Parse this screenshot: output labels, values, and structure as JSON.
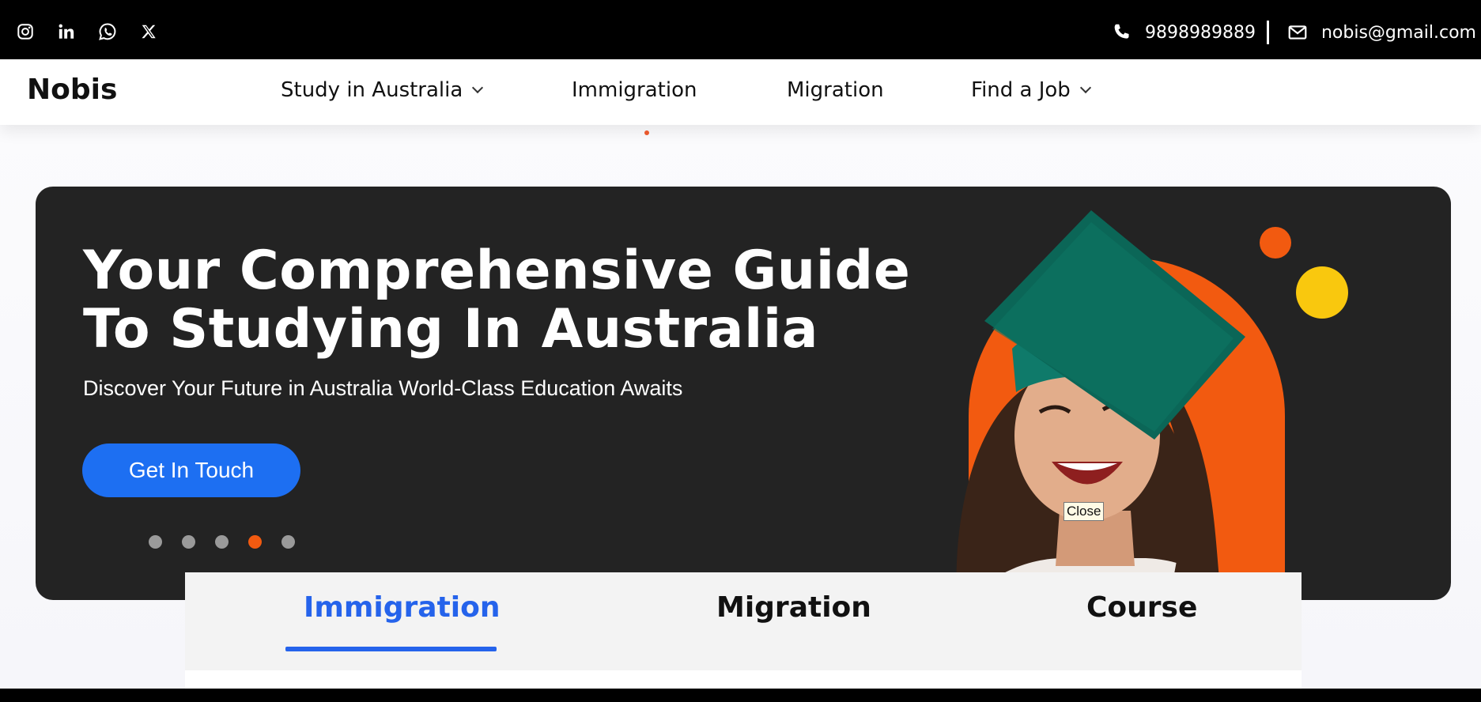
{
  "topbar": {
    "social_icons": [
      "instagram-icon",
      "linkedin-icon",
      "whatsapp-icon",
      "x-twitter-icon"
    ],
    "phone": "9898989889",
    "email": "nobis@gmail.com"
  },
  "navbar": {
    "logo": "Nobis",
    "items": [
      {
        "label": "Study in Australia",
        "has_dropdown": true
      },
      {
        "label": "Immigration",
        "has_dropdown": false
      },
      {
        "label": "Migration",
        "has_dropdown": false
      },
      {
        "label": "Find a Job",
        "has_dropdown": true
      }
    ]
  },
  "hero": {
    "title": "Your Comprehensive Guide To Studying In Australia",
    "subtitle": "Discover Your Future in Australia World-Class Education Awaits",
    "cta_label": "Get In Touch",
    "slides": 5,
    "active_slide": 4,
    "tooltip": "Close"
  },
  "tabs": {
    "items": [
      "Immigration",
      "Migration",
      "Course"
    ],
    "active": "Immigration"
  },
  "colors": {
    "accent_blue": "#2563eb",
    "cta_blue": "#1d6ff2",
    "orange": "#f25a10",
    "yellow": "#f9c80e",
    "hero_bg": "#232323"
  }
}
